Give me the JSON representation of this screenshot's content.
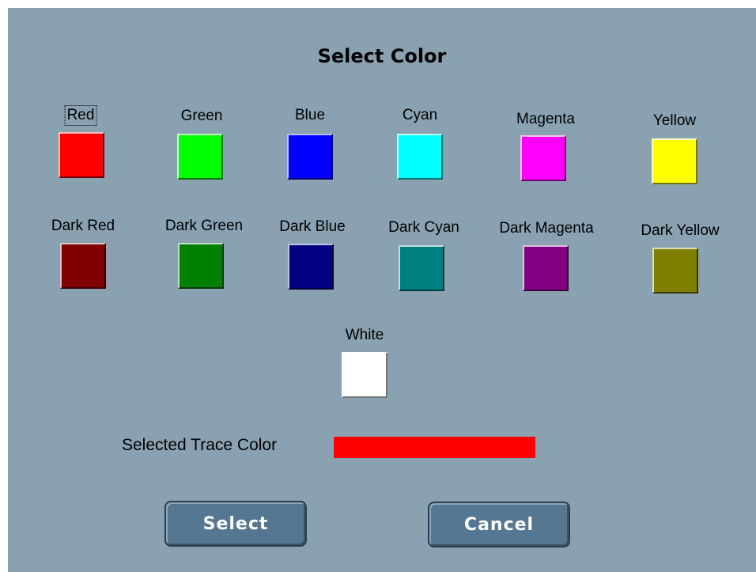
{
  "dialog": {
    "title": "Select Color"
  },
  "swatches": {
    "red": {
      "label": "Red",
      "color": "#ff0000"
    },
    "green": {
      "label": "Green",
      "color": "#00ff00"
    },
    "blue": {
      "label": "Blue",
      "color": "#0000ff"
    },
    "cyan": {
      "label": "Cyan",
      "color": "#00ffff"
    },
    "magenta": {
      "label": "Magenta",
      "color": "#ff00ff"
    },
    "yellow": {
      "label": "Yellow",
      "color": "#ffff00"
    },
    "dark_red": {
      "label": "Dark Red",
      "color": "#800000"
    },
    "dark_green": {
      "label": "Dark Green",
      "color": "#008000"
    },
    "dark_blue": {
      "label": "Dark Blue",
      "color": "#000080"
    },
    "dark_cyan": {
      "label": "Dark Cyan",
      "color": "#008080"
    },
    "dark_magenta": {
      "label": "Dark Magenta",
      "color": "#800080"
    },
    "dark_yellow": {
      "label": "Dark Yellow",
      "color": "#808000"
    },
    "white": {
      "label": "White",
      "color": "#ffffff"
    }
  },
  "selection": {
    "label": "Selected Trace Color",
    "color": "#ff0000",
    "focused_swatch": "Red"
  },
  "buttons": {
    "select_label": "Select",
    "cancel_label": "Cancel"
  },
  "theme": {
    "panel_bg": "#8aa1b1",
    "button_bg": "#557792"
  }
}
